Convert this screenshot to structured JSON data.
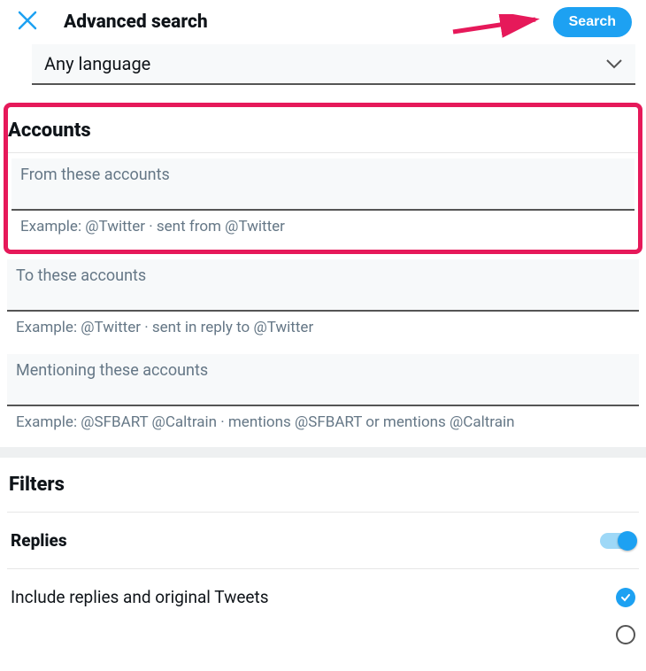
{
  "header": {
    "title": "Advanced search",
    "search_button": "Search"
  },
  "language": {
    "selected": "Any language"
  },
  "accounts": {
    "section_title": "Accounts",
    "from": {
      "label": "From these accounts",
      "example": "Example: @Twitter · sent from @Twitter"
    },
    "to": {
      "label": "To these accounts",
      "example": "Example: @Twitter · sent in reply to @Twitter"
    },
    "mentioning": {
      "label": "Mentioning these accounts",
      "example": "Example: @SFBART @Caltrain · mentions @SFBART or mentions @Caltrain"
    }
  },
  "filters": {
    "section_title": "Filters",
    "replies_label": "Replies",
    "include_replies_label": "Include replies and original Tweets"
  }
}
